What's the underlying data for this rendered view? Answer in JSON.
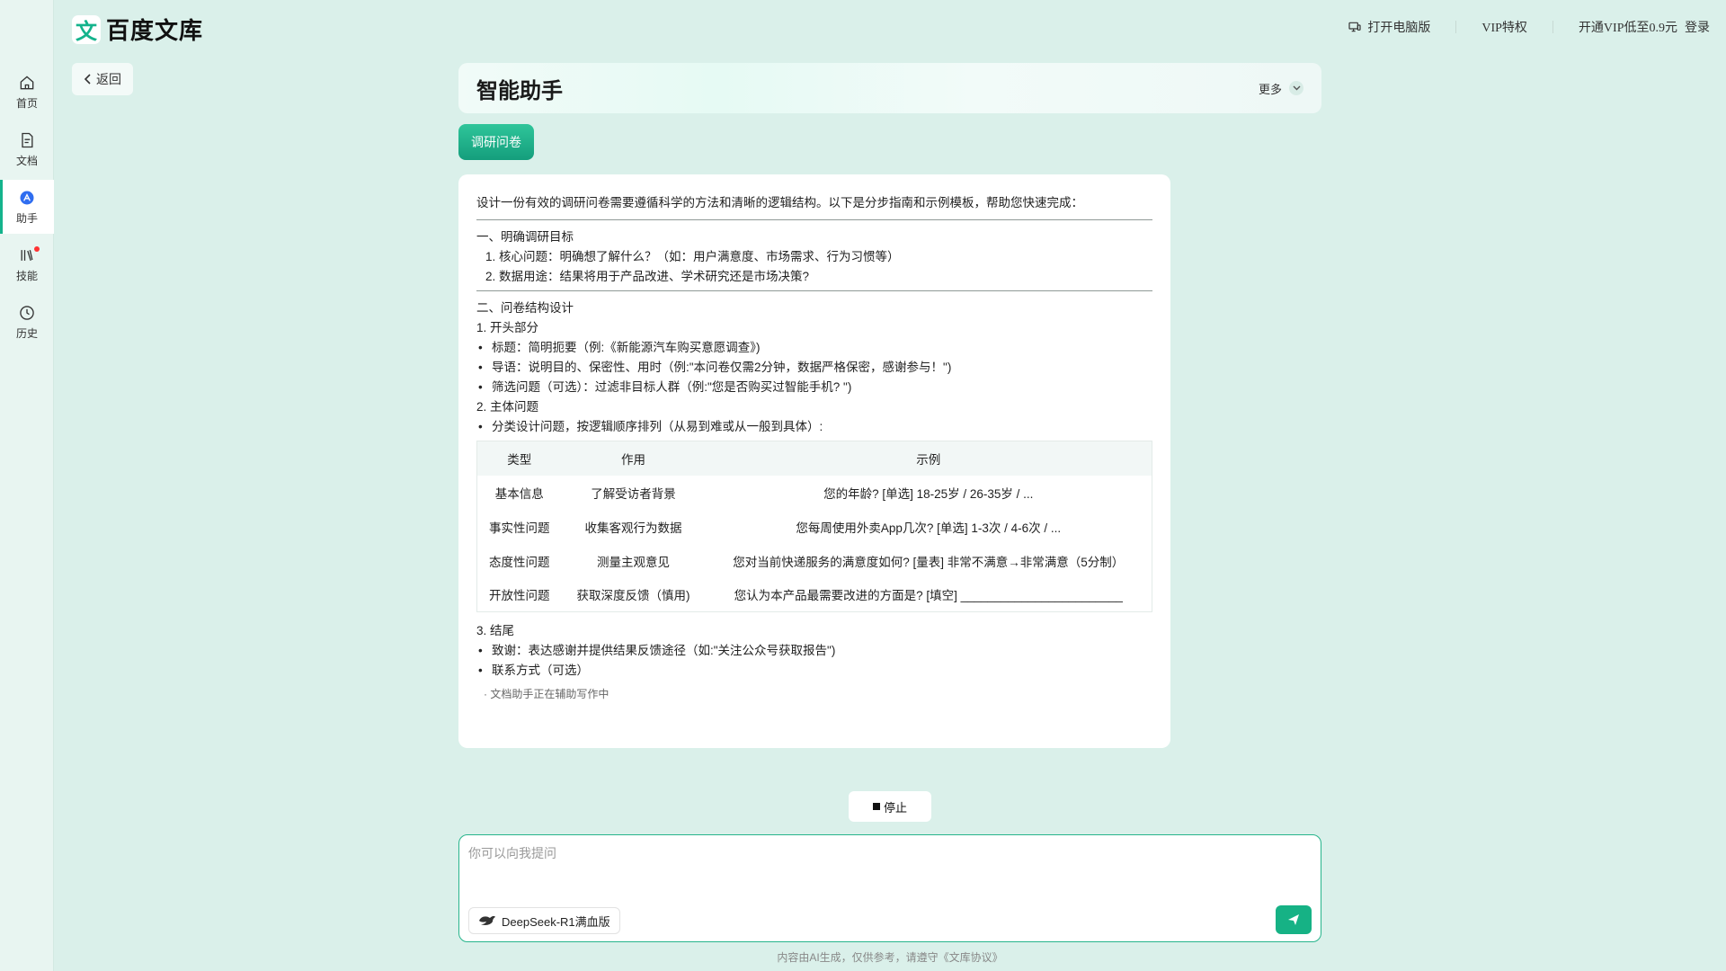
{
  "brand": {
    "logo_glyph": "文",
    "name": "百度文库"
  },
  "sidebar": {
    "items": [
      {
        "label": "首页",
        "icon": "home-icon"
      },
      {
        "label": "文档",
        "icon": "document-icon"
      },
      {
        "label": "助手",
        "icon": "assistant-icon",
        "active": true
      },
      {
        "label": "技能",
        "icon": "skills-icon",
        "badge": true
      },
      {
        "label": "历史",
        "icon": "history-icon"
      }
    ]
  },
  "topbar": {
    "open_pc": "打开电脑版",
    "vip": "VIP特权",
    "promo": "开通VIP低至0.9元",
    "login": "登录"
  },
  "back": {
    "label": "返回"
  },
  "header": {
    "title": "智能助手",
    "more": "更多"
  },
  "tag": {
    "label": "调研问卷"
  },
  "answer": {
    "intro": "设计一份有效的调研问卷需要遵循科学的方法和清晰的逻辑结构。以下是分步指南和示例模板，帮助您快速完成：",
    "section1": {
      "title": "一、明确调研目标",
      "items": [
        "1. 核心问题：明确想了解什么？（如：用户满意度、市场需求、行为习惯等）",
        "2. 数据用途：结果将用于产品改进、学术研究还是市场决策?"
      ]
    },
    "section2": {
      "title": "二、问卷结构设计",
      "part1_title": "1. 开头部分",
      "part1_bullets": [
        "标题：简明扼要（例:《新能源汽车购买意愿调查》)",
        "导语：说明目的、保密性、用时（例:\"本问卷仅需2分钟，数据严格保密，感谢参与！\")",
        "筛选问题（可选）：过滤非目标人群（例:\"您是否购买过智能手机? \")"
      ],
      "part2_title": "2. 主体问题",
      "part2_bullets": [
        "分类设计问题，按逻辑顺序排列（从易到难或从一般到具体）:"
      ],
      "table": {
        "headers": [
          "类型",
          "作用",
          "示例"
        ],
        "rows": [
          [
            "基本信息",
            "了解受访者背景",
            "您的年龄? [单选] 18-25岁 / 26-35岁 / ..."
          ],
          [
            "事实性问题",
            "收集客观行为数据",
            "您每周使用外卖App几次? [单选] 1-3次 / 4-6次 / ..."
          ],
          [
            "态度性问题",
            "测量主观意见",
            "您对当前快递服务的满意度如何? [量表] 非常不满意→非常满意（5分制）"
          ],
          [
            "开放性问题",
            "获取深度反馈（慎用)",
            "您认为本产品最需要改进的方面是? [填空] ________________________"
          ]
        ]
      },
      "part3_title": "3. 结尾",
      "part3_bullets": [
        "致谢：表达感谢并提供结果反馈途径（如:\"关注公众号获取报告\")",
        "联系方式（可选）"
      ]
    },
    "status": "· 文档助手正在辅助写作中"
  },
  "stop": {
    "label": "停止"
  },
  "input": {
    "placeholder": "你可以向我提问",
    "model": "DeepSeek-R1满血版"
  },
  "footer": "内容由AI生成，仅供参考，请遵守《文库协议》"
}
